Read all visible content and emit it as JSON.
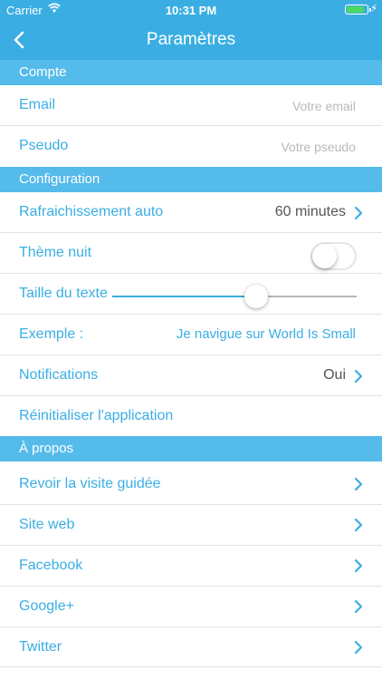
{
  "status_bar": {
    "carrier": "Carrier",
    "time": "10:31 PM",
    "battery_level": 0.85,
    "wifi_icon": "wifi-icon",
    "charging_icon": "bolt-icon"
  },
  "nav": {
    "title": "Paramètres",
    "back_icon": "chevron-left-icon"
  },
  "colors": {
    "accent": "#3aaee3",
    "section_bg": "#55bbea",
    "value_text": "#555555",
    "placeholder": "#b9b9b9",
    "switch_border": "#e5e5e5"
  },
  "sections": {
    "compte": "Compte",
    "configuration": "Configuration",
    "apropos": "À propos"
  },
  "compte": {
    "email_label": "Email",
    "email_placeholder": "Votre email",
    "pseudo_label": "Pseudo",
    "pseudo_placeholder": "Votre pseudo"
  },
  "config": {
    "refresh_label": "Rafraichissement auto",
    "refresh_value": "60 minutes",
    "night_label": "Thème nuit",
    "night_on": false,
    "text_size_label": "Taille du texte",
    "text_size_level": 0.59,
    "example_label": "Exemple :",
    "example_text": "Je navigue sur World Is Small",
    "notifications_label": "Notifications",
    "notifications_value": "Oui",
    "reset_label": "Réinitialiser l'application"
  },
  "about": {
    "items": [
      "Revoir la visite guidée",
      "Site web",
      "Facebook",
      "Google+",
      "Twitter"
    ]
  }
}
